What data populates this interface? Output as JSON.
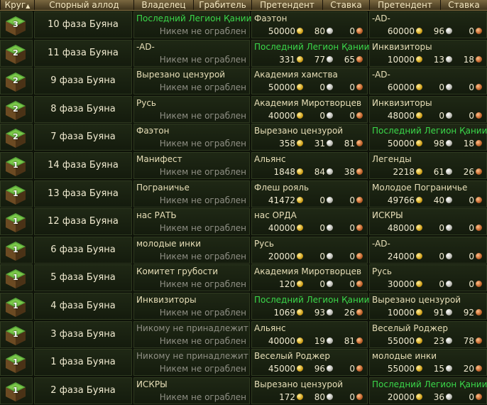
{
  "header": {
    "round": "Круг",
    "round_sort_icon": "sort-up-arrow-icon",
    "allod": "Спорный аллод",
    "owner": "Владелец",
    "robber": "Грабитель",
    "claimant1": "Претендент",
    "bid1": "Ставка",
    "claimant2": "Претендент",
    "bid2": "Ставка"
  },
  "no_rob_text": "Никем не ограблен",
  "rows": [
    {
      "round": "3",
      "name": "10 фаза Буяна",
      "owner": "Последний Легион Қании",
      "owner_color": "green",
      "p1": "Фаэтон",
      "p1_color": "normal",
      "p1_gold": "50000",
      "p1_silver": "80",
      "p1_copper": "0",
      "p2": "-AD-",
      "p2_color": "normal",
      "p2_gold": "60000",
      "p2_silver": "96",
      "p2_copper": "0"
    },
    {
      "round": "2",
      "name": "11 фаза Буяна",
      "owner": "-AD-",
      "owner_color": "normal",
      "p1": "Последний Легион Қании",
      "p1_color": "green",
      "p1_gold": "331",
      "p1_silver": "77",
      "p1_copper": "65",
      "p2": "Инквизиторы",
      "p2_color": "normal",
      "p2_gold": "10000",
      "p2_silver": "13",
      "p2_copper": "18"
    },
    {
      "round": "2",
      "name": "9 фаза Буяна",
      "owner": "Вырезано цензурой",
      "owner_color": "normal",
      "p1": "Академия хамства",
      "p1_color": "normal",
      "p1_gold": "50000",
      "p1_silver": "0",
      "p1_copper": "0",
      "p2": "-AD-",
      "p2_color": "normal",
      "p2_gold": "60000",
      "p2_silver": "0",
      "p2_copper": "0"
    },
    {
      "round": "2",
      "name": "8 фаза Буяна",
      "owner": "Русь",
      "owner_color": "normal",
      "p1": "Академия Миротворцев",
      "p1_color": "normal",
      "p1_gold": "40000",
      "p1_silver": "0",
      "p1_copper": "0",
      "p2": "Инквизиторы",
      "p2_color": "normal",
      "p2_gold": "48000",
      "p2_silver": "0",
      "p2_copper": "0"
    },
    {
      "round": "2",
      "name": "7 фаза Буяна",
      "owner": "Фаэтон",
      "owner_color": "normal",
      "p1": "Вырезано цензурой",
      "p1_color": "normal",
      "p1_gold": "358",
      "p1_silver": "31",
      "p1_copper": "81",
      "p2": "Последний Легион Қании",
      "p2_color": "green",
      "p2_gold": "50000",
      "p2_silver": "98",
      "p2_copper": "18"
    },
    {
      "round": "1",
      "name": "14 фаза Буяна",
      "owner": "Манифест",
      "owner_color": "normal",
      "p1": "Альянс",
      "p1_color": "normal",
      "p1_gold": "1848",
      "p1_silver": "84",
      "p1_copper": "38",
      "p2": "Легенды",
      "p2_color": "normal",
      "p2_gold": "2218",
      "p2_silver": "61",
      "p2_copper": "26"
    },
    {
      "round": "1",
      "name": "13 фаза Буяна",
      "owner": "Пограничье",
      "owner_color": "normal",
      "p1": "Флеш рояль",
      "p1_color": "normal",
      "p1_gold": "41472",
      "p1_silver": "0",
      "p1_copper": "0",
      "p2": "Молодое Пограничье",
      "p2_color": "normal",
      "p2_gold": "49766",
      "p2_silver": "40",
      "p2_copper": "0"
    },
    {
      "round": "1",
      "name": "12 фаза Буяна",
      "owner": "нас РАТЬ",
      "owner_color": "normal",
      "p1": "нас ОРДА",
      "p1_color": "normal",
      "p1_gold": "40000",
      "p1_silver": "0",
      "p1_copper": "0",
      "p2": "ИСКРЫ",
      "p2_color": "normal",
      "p2_gold": "48000",
      "p2_silver": "0",
      "p2_copper": "0"
    },
    {
      "round": "1",
      "name": "6 фаза Буяна",
      "owner": "молодые инки",
      "owner_color": "normal",
      "p1": "Русь",
      "p1_color": "normal",
      "p1_gold": "20000",
      "p1_silver": "0",
      "p1_copper": "0",
      "p2": "-AD-",
      "p2_color": "normal",
      "p2_gold": "24000",
      "p2_silver": "0",
      "p2_copper": "0"
    },
    {
      "round": "1",
      "name": "5 фаза Буяна",
      "owner": "Комитет грубости",
      "owner_color": "normal",
      "p1": "Академия Миротворцев",
      "p1_color": "normal",
      "p1_gold": "120",
      "p1_silver": "0",
      "p1_copper": "0",
      "p2": "Русь",
      "p2_color": "normal",
      "p2_gold": "30000",
      "p2_silver": "0",
      "p2_copper": "0"
    },
    {
      "round": "1",
      "name": "4 фаза Буяна",
      "owner": "Инквизиторы",
      "owner_color": "normal",
      "p1": "Последний Легион Қании",
      "p1_color": "green",
      "p1_gold": "1069",
      "p1_silver": "93",
      "p1_copper": "26",
      "p2": "Вырезано цензурой",
      "p2_color": "normal",
      "p2_gold": "10000",
      "p2_silver": "91",
      "p2_copper": "92"
    },
    {
      "round": "1",
      "name": "3 фаза Буяна",
      "owner": "Никому не принадлежит",
      "owner_color": "gray",
      "p1": "Альянс",
      "p1_color": "normal",
      "p1_gold": "40000",
      "p1_silver": "19",
      "p1_copper": "81",
      "p2": "Веселый Роджер",
      "p2_color": "normal",
      "p2_gold": "55000",
      "p2_silver": "23",
      "p2_copper": "78"
    },
    {
      "round": "1",
      "name": "1 фаза Буяна",
      "owner": "Никому не принадлежит",
      "owner_color": "gray",
      "p1": "Веселый Роджер",
      "p1_color": "normal",
      "p1_gold": "45000",
      "p1_silver": "96",
      "p1_copper": "0",
      "p2": "молодые инки",
      "p2_color": "normal",
      "p2_gold": "55000",
      "p2_silver": "15",
      "p2_copper": "20"
    },
    {
      "round": "1",
      "name": "2 фаза Буяна",
      "owner": "ИСКРЫ",
      "owner_color": "normal",
      "p1": "Вырезано цензурой",
      "p1_color": "normal",
      "p1_gold": "172",
      "p1_silver": "80",
      "p1_copper": "0",
      "p2": "Последний Легион Қании",
      "p2_color": "green",
      "p2_gold": "20000",
      "p2_silver": "36",
      "p2_copper": "0"
    }
  ],
  "colors": {
    "green": "#3ad84a",
    "gray": "#8f8f84",
    "normal": "#e8dfb8"
  },
  "icons": {
    "round_badge": "cube-island-icon",
    "gold": "gold-coin-icon",
    "silver": "silver-coin-icon",
    "copper": "copper-coin-icon"
  }
}
